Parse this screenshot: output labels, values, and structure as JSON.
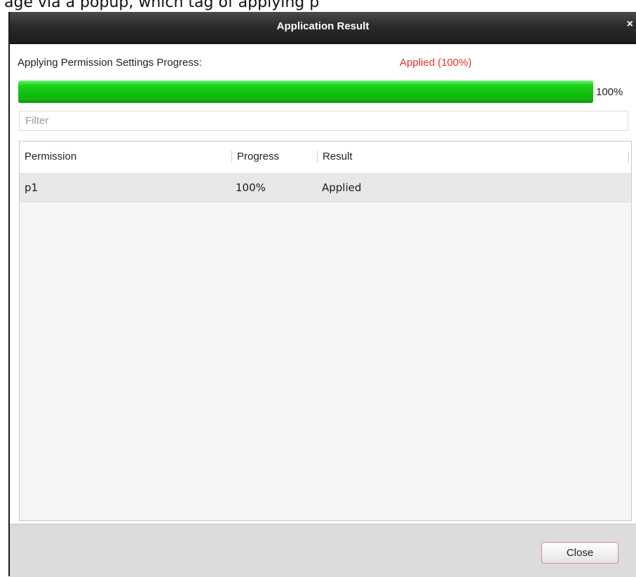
{
  "caption": "age via a popup, which tag of applying p",
  "dialog": {
    "title": "Application Result",
    "close_glyph": "×"
  },
  "progress": {
    "label": "Applying Permission Settings Progress:",
    "status": "Applied (100%)",
    "status_color": "#e8302f",
    "bar_fraction": 1.0,
    "percent_label": "100%",
    "bar_color": "#14c814"
  },
  "filter": {
    "placeholder": "Filter",
    "value": ""
  },
  "table": {
    "columns": [
      "Permission",
      "Progress",
      "Result"
    ],
    "rows": [
      {
        "permission": "p1",
        "progress": "100%",
        "result": "Applied"
      }
    ]
  },
  "footer": {
    "close_label": "Close"
  }
}
